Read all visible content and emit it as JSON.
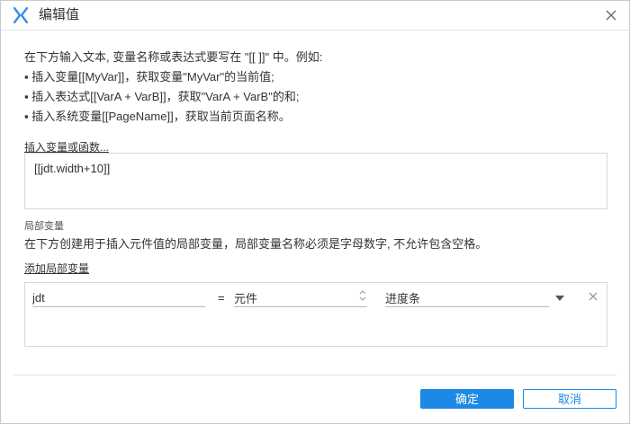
{
  "window": {
    "title": "编辑值",
    "logo_icon": "axure-x-logo-icon",
    "close_icon": "close-icon"
  },
  "instructions": {
    "lines": [
      "在下方输入文本, 变量名称或表达式要写在 \"[[ ]]\" 中。例如:",
      "▪ 插入变量[[MyVar]]，获取变量\"MyVar\"的当前值;",
      "▪ 插入表达式[[VarA + VarB]]，获取\"VarA + VarB\"的和;",
      "▪ 插入系统变量[[PageName]]，获取当前页面名称。"
    ],
    "insert_link": "插入变量或函数..."
  },
  "expression": {
    "value": "[[jdt.width+10]]"
  },
  "local_vars": {
    "heading": "局部变量",
    "description": "在下方创建用于插入元件值的局部变量，局部变量名称必须是字母数字, 不允许包含空格。",
    "add_link": "添加局部变量",
    "rows": [
      {
        "name": "jdt",
        "equals": "=",
        "type": "元件",
        "target": "进度条"
      }
    ]
  },
  "buttons": {
    "ok": "确定",
    "cancel": "取消"
  },
  "colors": {
    "accent": "#1e88e5",
    "logo_blue": "#3a8ee6",
    "border": "#d8d8d8"
  }
}
